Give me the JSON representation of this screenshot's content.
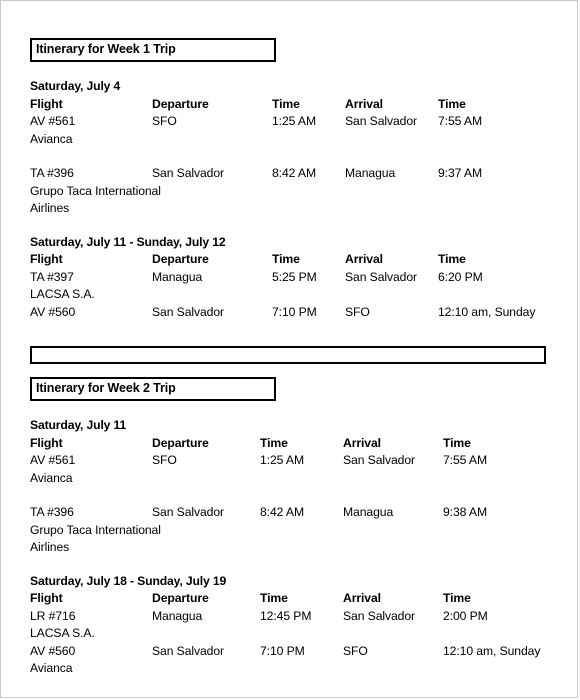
{
  "document": {
    "columns": [
      "Flight",
      "Departure",
      "Time",
      "Arrival",
      "Time"
    ],
    "sections": [
      {
        "heading": "Itinerary for Week 1 Trip",
        "blocks": [
          {
            "date": "Saturday, July 4",
            "rows": [
              {
                "flight": "AV #561",
                "departure": "SFO",
                "dep_time": "1:25 AM",
                "arrival": "San Salvador",
                "arr_time": "7:55 AM"
              },
              {
                "flight": "Avianca",
                "departure": "",
                "dep_time": "",
                "arrival": "",
                "arr_time": ""
              },
              {
                "flight": "",
                "departure": "",
                "dep_time": "",
                "arrival": "",
                "arr_time": ""
              },
              {
                "flight": "TA #396",
                "departure": "San Salvador",
                "dep_time": "8:42 AM",
                "arrival": "Managua",
                "arr_time": "9:37 AM"
              },
              {
                "flight": "Grupo Taca International",
                "departure": "",
                "dep_time": "",
                "arrival": "",
                "arr_time": ""
              },
              {
                "flight": "Airlines",
                "departure": "",
                "dep_time": "",
                "arrival": "",
                "arr_time": ""
              }
            ]
          },
          {
            "date": "Saturday, July 11 - Sunday, July 12",
            "rows": [
              {
                "flight": "TA #397",
                "departure": "Managua",
                "dep_time": "5:25 PM",
                "arrival": "San Salvador",
                "arr_time": "6:20 PM"
              },
              {
                "flight": "LACSA S.A.",
                "departure": "",
                "dep_time": "",
                "arrival": "",
                "arr_time": ""
              },
              {
                "flight": "AV #560",
                "departure": "San Salvador",
                "dep_time": "7:10 PM",
                "arrival": "SFO",
                "arr_time": "12:10 am, Sunday"
              }
            ]
          }
        ]
      },
      {
        "heading": "Itinerary for Week 2 Trip",
        "blocks": [
          {
            "date": "Saturday, July 11",
            "rows": [
              {
                "flight": "AV #561",
                "departure": "SFO",
                "dep_time": "1:25 AM",
                "arrival": "San Salvador",
                "arr_time": "7:55 AM"
              },
              {
                "flight": "Avianca",
                "departure": "",
                "dep_time": "",
                "arrival": "",
                "arr_time": ""
              },
              {
                "flight": "",
                "departure": "",
                "dep_time": "",
                "arrival": "",
                "arr_time": ""
              },
              {
                "flight": "TA #396",
                "departure": "San Salvador",
                "dep_time": "8:42 AM",
                "arrival": "Managua",
                "arr_time": "9:38 AM"
              },
              {
                "flight": "Grupo Taca International",
                "departure": "",
                "dep_time": "",
                "arrival": "",
                "arr_time": ""
              },
              {
                "flight": "Airlines",
                "departure": "",
                "dep_time": "",
                "arrival": "",
                "arr_time": ""
              }
            ]
          },
          {
            "date": "Saturday, July 18 - Sunday, July 19",
            "rows": [
              {
                "flight": "LR #716",
                "departure": "Managua",
                "dep_time": "12:45 PM",
                "arrival": "San Salvador",
                "arr_time": "2:00 PM"
              },
              {
                "flight": "LACSA S.A.",
                "departure": "",
                "dep_time": "",
                "arrival": "",
                "arr_time": ""
              },
              {
                "flight": "AV #560",
                "departure": "San Salvador",
                "dep_time": "7:10 PM",
                "arrival": "SFO",
                "arr_time": "12:10 am, Sunday"
              },
              {
                "flight": "Avianca",
                "departure": "",
                "dep_time": "",
                "arrival": "",
                "arr_time": ""
              }
            ]
          }
        ]
      }
    ]
  }
}
